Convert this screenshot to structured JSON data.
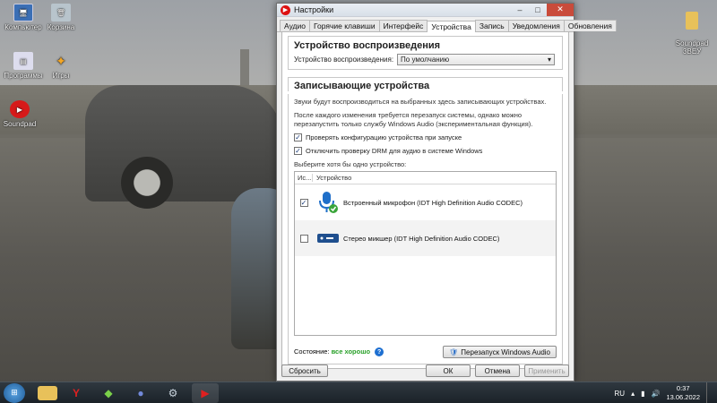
{
  "desktop": {
    "icons": [
      {
        "label": "Компьютер",
        "icon": "computer-icon"
      },
      {
        "label": "Корзина",
        "icon": "recycle-bin-icon"
      },
      {
        "label": "Программы",
        "icon": "programs-icon"
      },
      {
        "label": "Игры",
        "icon": "games-icon"
      },
      {
        "label": "Soundpad",
        "icon": "soundpad-icon"
      },
      {
        "label": "Soundpad\nЗВЕУ",
        "icon": "folder-icon"
      }
    ]
  },
  "window": {
    "title": "Настройки",
    "tabs": [
      {
        "label": "Аудио"
      },
      {
        "label": "Горячие клавиши"
      },
      {
        "label": "Интерфейс"
      },
      {
        "label": "Устройства"
      },
      {
        "label": "Запись"
      },
      {
        "label": "Уведомления"
      },
      {
        "label": "Обновления"
      }
    ],
    "active_tab": "Устройства",
    "playback": {
      "title": "Устройство воспроизведения",
      "label": "Устройство воспроизведения:",
      "selected": "По умолчанию"
    },
    "recording": {
      "title": "Записывающие устройства",
      "desc1": "Звуки будут воспроизводиться на выбранных здесь записывающих устройствах.",
      "desc2": "После каждого изменения требуется перезапуск системы, однако можно перезапустить только службу Windows Audio (экспериментальная функция).",
      "check1": "Проверять конфигурацию устройства при запуске",
      "check2": "Отключить проверку DRM для аудио в системе Windows",
      "choose": "Выберите хотя бы одно устройство:",
      "col_use": "Ис...",
      "col_device": "Устройство",
      "devices": [
        {
          "name": "Встроенный микрофон (IDT High Definition Audio CODEC)",
          "checked": true,
          "icon": "microphone-icon"
        },
        {
          "name": "Стерео микшер (IDT High Definition Audio CODEC)",
          "checked": false,
          "icon": "stereo-mixer-icon"
        }
      ],
      "status_label": "Состояние:",
      "status_value": "все хорошо",
      "restart_button": "Перезапуск Windows Audio"
    },
    "footer": {
      "reset": "Сбросить",
      "ok": "ОК",
      "cancel": "Отмена",
      "apply": "Применить"
    }
  },
  "taskbar": {
    "apps": [
      "explorer-icon",
      "yandex-browser-icon",
      "bluestacks-icon",
      "discord-icon",
      "steam-icon",
      "soundpad-icon"
    ],
    "lang": "RU",
    "time": "0:37",
    "date": "13.06.2022"
  }
}
